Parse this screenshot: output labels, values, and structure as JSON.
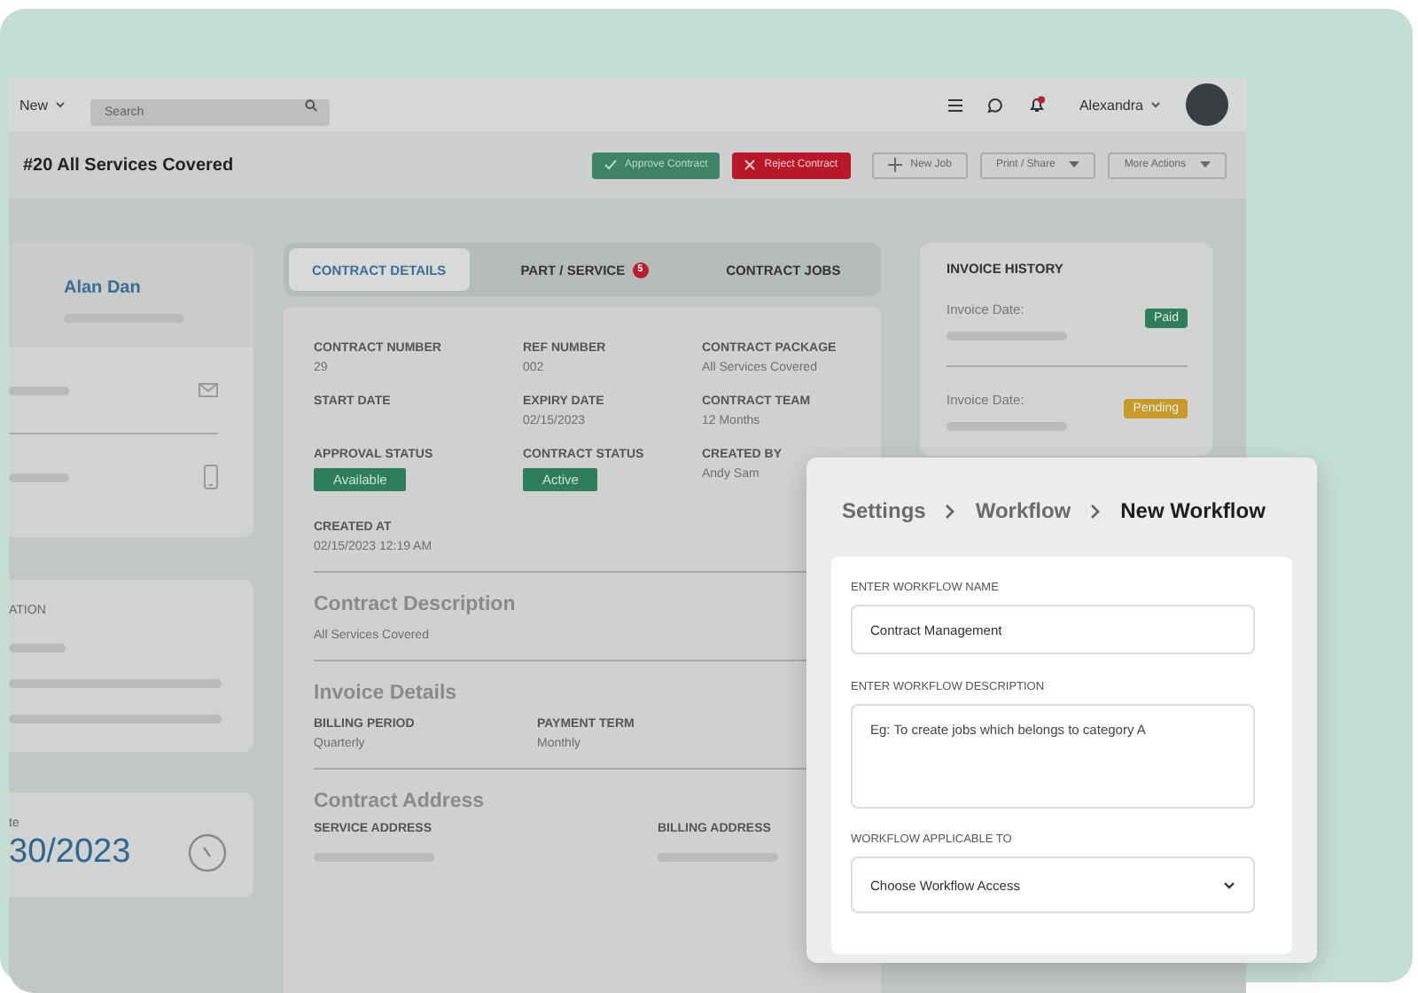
{
  "topbar": {
    "new_menu": "New",
    "search": {
      "placeholder": "Search"
    },
    "notifications_unread": true,
    "user": "Alexandra"
  },
  "page_title": "#20 All Services Covered",
  "actions": [
    {
      "label": "Approve Contract",
      "kind": "approve"
    },
    {
      "label": "Reject Contract",
      "kind": "reject"
    },
    {
      "label": "New Job",
      "kind": "add"
    },
    {
      "label": "Print / Share",
      "kind": "menu"
    },
    {
      "label": "More Actions",
      "kind": "menu"
    }
  ],
  "customer": {
    "name": "Alan Dan"
  },
  "location_card": {
    "label": "ATION"
  },
  "date_card": {
    "label": "te",
    "value": "30/2023"
  },
  "tabs": [
    {
      "label": "CONTRACT DETAILS",
      "selected": true
    },
    {
      "label": "PART / SERVICE",
      "selected": false,
      "badge": "5"
    },
    {
      "label": "CONTRACT JOBS",
      "selected": false
    }
  ],
  "details": [
    {
      "label": "CONTRACT NUMBER",
      "value": "29",
      "kind": "text"
    },
    {
      "label": "REF NUMBER",
      "value": "002",
      "kind": "text"
    },
    {
      "label": "CONTRACT PACKAGE",
      "value": "All Services Covered",
      "kind": "text"
    },
    {
      "label": "START DATE"
    },
    {
      "label": "EXPIRY DATE",
      "value": "02/15/2023",
      "kind": "text"
    },
    {
      "label": "CONTRACT TEAM",
      "value": "12 Months",
      "kind": "text"
    },
    {
      "label": "APPROVAL STATUS",
      "value": "Available",
      "kind": "status"
    },
    {
      "label": "CONTRACT STATUS",
      "value": "Active",
      "kind": "status"
    },
    {
      "label": "CREATED BY",
      "value": "Andy Sam",
      "kind": "text"
    },
    {
      "label": "CREATED AT",
      "value": "02/15/2023 12:19 AM",
      "kind": "text"
    }
  ],
  "description": {
    "title": "Contract Description",
    "text": "All Services Covered"
  },
  "invoice_details": {
    "title": "Invoice Details",
    "fields": [
      {
        "label": "BILLING PERIOD",
        "value": "Quarterly"
      },
      {
        "label": "PAYMENT TERM",
        "value": "Monthly"
      }
    ]
  },
  "contract_address": {
    "title": "Contract Address",
    "fields": [
      {
        "label": "SERVICE ADDRESS"
      },
      {
        "label": "BILLING ADDRESS"
      }
    ]
  },
  "invoice_history": {
    "title": "INVOICE HISTORY",
    "items": [
      {
        "label": "Invoice Date:",
        "status": "Paid",
        "color": "#2f7d5d"
      },
      {
        "label": "Invoice Date:",
        "status": "Pending",
        "color": "#c79a2a"
      }
    ]
  },
  "workflow_modal": {
    "breadcrumb": [
      {
        "label": "Settings",
        "current": false
      },
      {
        "label": "Workflow",
        "current": false
      },
      {
        "label": "New Workflow",
        "current": true
      }
    ],
    "fields": [
      {
        "kind": "input",
        "label": "ENTER WORKFLOW NAME",
        "value": "Contract Management"
      },
      {
        "kind": "textarea",
        "label": "ENTER WORKFLOW DESCRIPTION",
        "placeholder": "Eg: To create jobs which belongs to category A"
      },
      {
        "kind": "select",
        "label": "WORKFLOW APPLICABLE TO",
        "placeholder": "Choose Workflow Access"
      }
    ]
  }
}
